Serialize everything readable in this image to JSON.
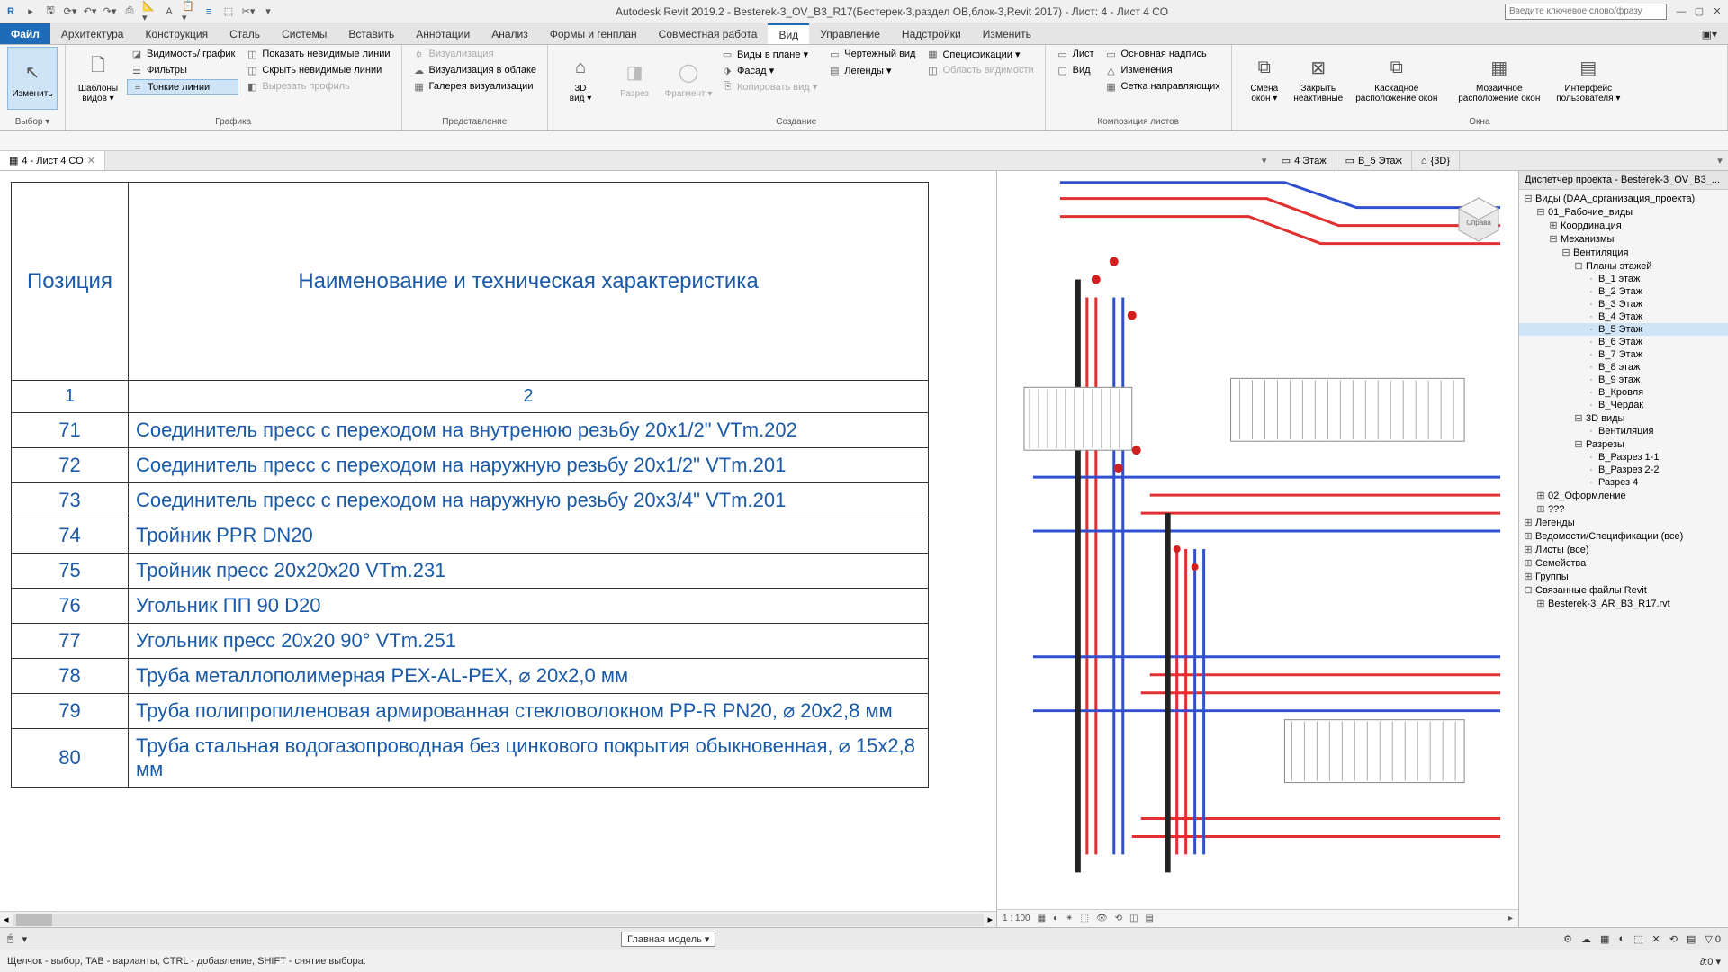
{
  "title": "Autodesk Revit 2019.2 - Besterek-3_OV_B3_R17(Бестерек-3,раздел ОВ,блок-3,Revit 2017) - Лист: 4 - Лист 4 СО",
  "search_placeholder": "Введите ключевое слово/фразу",
  "tabs": {
    "file": "Файл",
    "arch": "Архитектура",
    "konstr": "Конструкция",
    "stal": "Сталь",
    "sys": "Системы",
    "insert": "Вставить",
    "annot": "Аннотации",
    "anal": "Анализ",
    "forms": "Формы и генплан",
    "collab": "Совместная работа",
    "view": "Вид",
    "manage": "Управление",
    "addins": "Надстройки",
    "modify": "Изменить"
  },
  "ribbon": {
    "vybor": {
      "modify": "Изменить",
      "title": "Выбор ▾"
    },
    "grafika": {
      "shablony": "Шаблоны\nвидов ▾",
      "vidgraf": "Видимость/ график",
      "filtry": "Фильтры",
      "tonkie": "Тонкие линии",
      "pokaz": "Показать невидимые линии",
      "skryt": "Скрыть невидимые линии",
      "vyrez": "Вырезать профиль",
      "title": "Графика"
    },
    "pred": {
      "vizual": "Визуализация",
      "voblake": "Визуализация  в облаке",
      "galereya": "Галерея  визуализации",
      "title": "Представление"
    },
    "sozd": {
      "tri_d": "3D\nвид ▾",
      "razrez": "Разрез",
      "fragment": "Фрагмент ▾",
      "vplane": "Виды в плане ▾",
      "fasad": "Фасад ▾",
      "kopirovat": "Копировать вид ▾",
      "chert": "Чертежный вид",
      "legendy": "Легенды ▾",
      "spec": "Спецификации ▾",
      "oblast": "Область видимости",
      "title": "Создание"
    },
    "komp": {
      "list": "Лист",
      "vid": "Вид",
      "osnovnaya": "Основная надпись",
      "izmeneniya": "Изменения",
      "setka": "Сетка направляющих",
      "title": "Композиция листов"
    },
    "okna": {
      "smena": "Смена\nокон ▾",
      "zakryt": "Закрыть\nнеактивные",
      "kaskad": "Каскадное\nрасположение окон",
      "mozaich": "Мозаичное\nрасположение окон",
      "interfeis": "Интерфейс\nпользователя ▾",
      "title": "Окна"
    }
  },
  "viewtabs": {
    "sheet": "4 - Лист 4 СО",
    "s4": "4 Этаж",
    "v5": "В_5 Этаж",
    "td": "{3D}"
  },
  "sheet": {
    "hdr_pos": "Позиция",
    "hdr_name": "Наименование и техническая характеристика",
    "col1": "1",
    "col2": "2",
    "rows": [
      {
        "pos": "71",
        "name": "Соединитель пресс с переходом на внутренюю резьбу 20х1/2\" VTm.202"
      },
      {
        "pos": "72",
        "name": "Соединитель пресс с переходом на наружную резьбу 20х1/2\" VTm.201"
      },
      {
        "pos": "73",
        "name": "Соединитель пресс с переходом на наружную резьбу 20х3/4\" VTm.201"
      },
      {
        "pos": "74",
        "name": "Тройник PPR DN20"
      },
      {
        "pos": "75",
        "name": "Тройник пресс 20х20х20 VTm.231"
      },
      {
        "pos": "76",
        "name": "Угольник ПП 90 D20"
      },
      {
        "pos": "77",
        "name": "Угольник пресс 20х20 90° VTm.251"
      },
      {
        "pos": "78",
        "name": "Труба металлополимерная PEX-AL-PEX, ⌀ 20x2,0 мм"
      },
      {
        "pos": "79",
        "name": "Труба полипропиленовая армированная стекловолокном PP-R PN20, ⌀ 20x2,8 мм"
      },
      {
        "pos": "80",
        "name": "Труба стальная водогазопроводная без цинкового покрытия обыкновенная, ⌀ 15x2,8 мм"
      }
    ]
  },
  "viewcube": "Справа",
  "scale": "1 : 100",
  "project": {
    "title": "Диспетчер проекта - Besterek-3_OV_B3_...",
    "items": [
      {
        "l": 0,
        "tw": "⊟",
        "t": "Виды (DAA_организация_проекта)"
      },
      {
        "l": 1,
        "tw": "⊟",
        "t": "01_Рабочие_виды"
      },
      {
        "l": 2,
        "tw": "⊞",
        "t": "Координация"
      },
      {
        "l": 2,
        "tw": "⊟",
        "t": "Механизмы"
      },
      {
        "l": 3,
        "tw": "⊟",
        "t": "Вентиляция"
      },
      {
        "l": 4,
        "tw": "⊟",
        "t": "Планы этажей"
      },
      {
        "l": 5,
        "tw": "",
        "t": "В_1 этаж"
      },
      {
        "l": 5,
        "tw": "",
        "t": "В_2 Этаж"
      },
      {
        "l": 5,
        "tw": "",
        "t": "В_3 Этаж"
      },
      {
        "l": 5,
        "tw": "",
        "t": "В_4 Этаж"
      },
      {
        "l": 5,
        "tw": "",
        "t": "В_5 Этаж",
        "sel": true
      },
      {
        "l": 5,
        "tw": "",
        "t": "В_6 Этаж"
      },
      {
        "l": 5,
        "tw": "",
        "t": "В_7 Этаж"
      },
      {
        "l": 5,
        "tw": "",
        "t": "В_8 этаж"
      },
      {
        "l": 5,
        "tw": "",
        "t": "В_9 этаж"
      },
      {
        "l": 5,
        "tw": "",
        "t": "В_Кровля"
      },
      {
        "l": 5,
        "tw": "",
        "t": "В_Чердак"
      },
      {
        "l": 4,
        "tw": "⊟",
        "t": "3D виды"
      },
      {
        "l": 5,
        "tw": "",
        "t": "Вентиляция"
      },
      {
        "l": 4,
        "tw": "⊟",
        "t": "Разрезы"
      },
      {
        "l": 5,
        "tw": "",
        "t": "В_Разрез 1-1"
      },
      {
        "l": 5,
        "tw": "",
        "t": "В_Разрез 2-2"
      },
      {
        "l": 5,
        "tw": "",
        "t": "Разрез 4"
      },
      {
        "l": 1,
        "tw": "⊞",
        "t": "02_Оформление"
      },
      {
        "l": 1,
        "tw": "⊞",
        "t": "???"
      },
      {
        "l": 0,
        "tw": "⊞",
        "t": "Легенды"
      },
      {
        "l": 0,
        "tw": "⊞",
        "t": "Ведомости/Спецификации (все)"
      },
      {
        "l": 0,
        "tw": "⊞",
        "t": "Листы (все)"
      },
      {
        "l": 0,
        "tw": "⊞",
        "t": "Семейства"
      },
      {
        "l": 0,
        "tw": "⊞",
        "t": "Группы"
      },
      {
        "l": 0,
        "tw": "⊟",
        "t": "Связанные файлы Revit"
      },
      {
        "l": 1,
        "tw": "⊞",
        "t": "Besterek-3_AR_B3_R17.rvt"
      }
    ]
  },
  "status": "Щелчок - выбор, TAB - варианты, CTRL - добавление, SHIFT - снятие выбора.",
  "toolbar": {
    "model": "Главная модель"
  }
}
